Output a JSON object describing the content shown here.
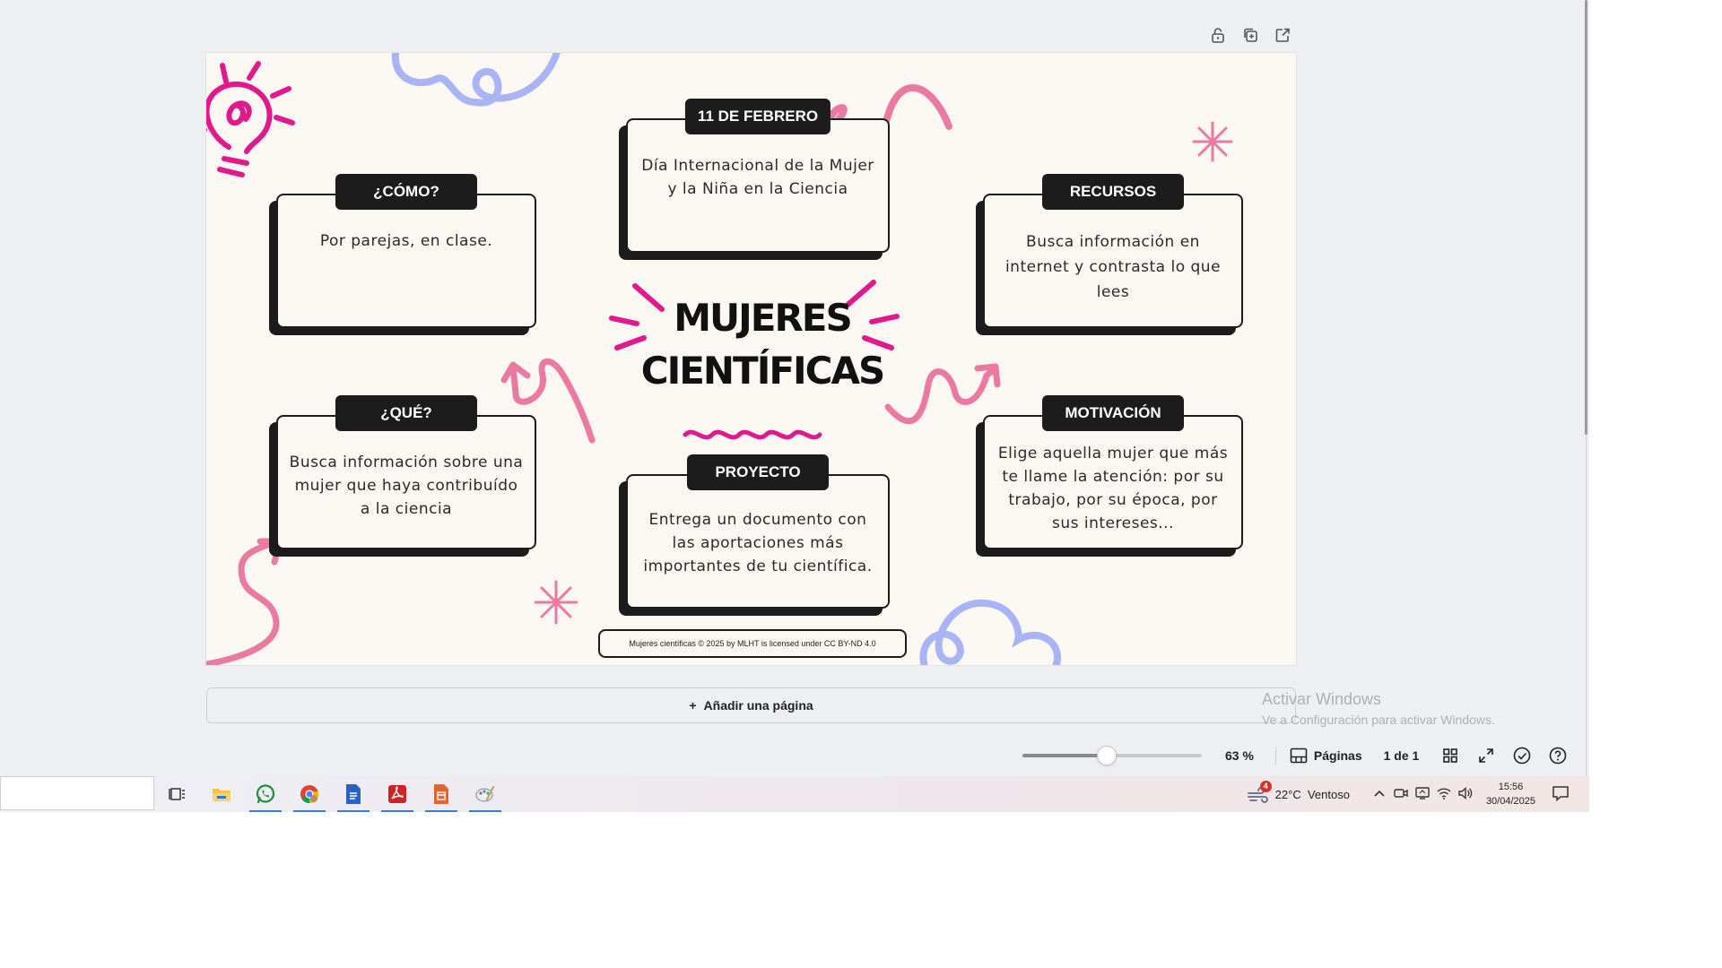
{
  "slide": {
    "title_line1": "MUJERES",
    "title_line2": "CIENTÍFICAS",
    "cards": {
      "fecha": {
        "label": "11 DE FEBRERO",
        "body": "Día Internacional de la Mujer y la Niña en la Ciencia"
      },
      "como": {
        "label": "¿CÓMO?",
        "body": "Por parejas, en clase."
      },
      "recursos": {
        "label": "RECURSOS",
        "body": "Busca información en internet y contrasta lo que lees"
      },
      "que": {
        "label": "¿QUÉ?",
        "body": "Busca información sobre una mujer que haya contribuído a la ciencia"
      },
      "proyecto": {
        "label": "PROYECTO",
        "body": "Entrega un documento con las aportaciones más importantes de tu científica."
      },
      "motivacion": {
        "label": "MOTIVACIÓN",
        "body": "Elige aquella mujer que más te llame la atención: por su trabajo, por su época, por sus intereses..."
      }
    },
    "credit": "Mujeres científicas © 2025 by MLHT is licensed under CC BY-ND 4.0",
    "colors": {
      "pink": "#ea7aa1",
      "magenta": "#e0198d",
      "lavender": "#a9b4f5",
      "dark": "#1c1c1c",
      "paper": "#fbf8f3"
    }
  },
  "page_toolbar": {
    "icons": [
      "lock-icon",
      "duplicate-icon",
      "share-icon"
    ]
  },
  "add_page": {
    "label": "Añadir una página"
  },
  "watermark": {
    "line1": "Activar Windows",
    "line2": "Ve a Configuración para activar Windows."
  },
  "status_bar": {
    "zoom_level": 0.47,
    "zoom_text": "63 %",
    "pages_label": "Páginas",
    "page_count": "1 de 1"
  },
  "taskbar": {
    "apps": [
      "task-view-icon",
      "file-explorer-icon",
      "whatsapp-icon",
      "chrome-icon",
      "word-icon",
      "acrobat-icon",
      "powerpoint-icon",
      "paint-icon"
    ],
    "weather_badge": "4",
    "weather": "22°C  Ventoso",
    "time": "15:56",
    "date": "30/04/2025"
  }
}
